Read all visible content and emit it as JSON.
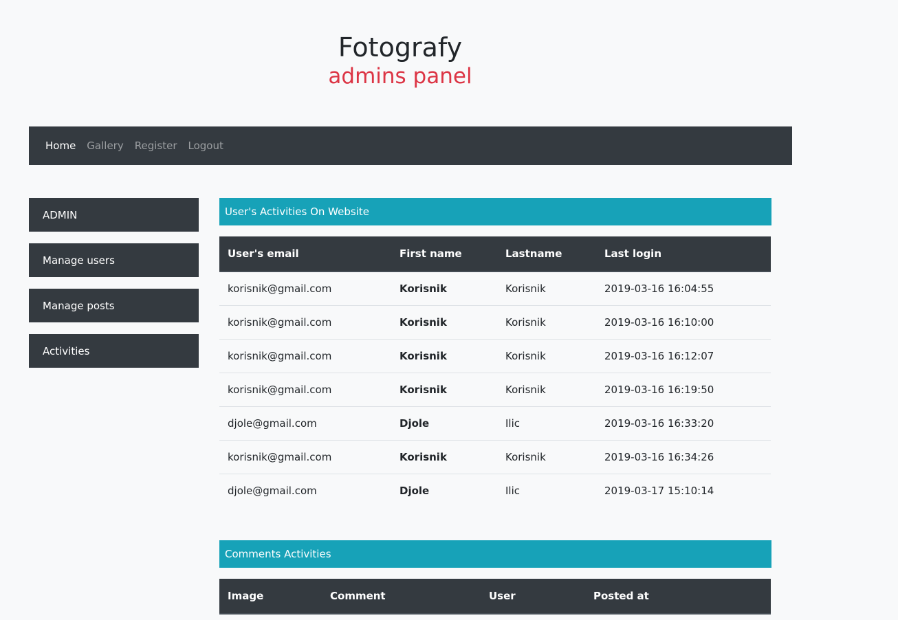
{
  "header": {
    "title": "Fotografy",
    "subtitle": "admins panel"
  },
  "navbar": {
    "links": [
      "Home",
      "Gallery",
      "Register",
      "Logout"
    ]
  },
  "sidebar": {
    "items": [
      "ADMIN",
      "Manage users",
      "Manage posts",
      "Activities"
    ]
  },
  "activities": {
    "title": "User's Activities On Website",
    "columns": [
      "User's email",
      "First name",
      "Lastname",
      "Last login"
    ],
    "rows": [
      [
        "korisnik@gmail.com",
        "Korisnik",
        "Korisnik",
        "2019-03-16 16:04:55"
      ],
      [
        "korisnik@gmail.com",
        "Korisnik",
        "Korisnik",
        "2019-03-16 16:10:00"
      ],
      [
        "korisnik@gmail.com",
        "Korisnik",
        "Korisnik",
        "2019-03-16 16:12:07"
      ],
      [
        "korisnik@gmail.com",
        "Korisnik",
        "Korisnik",
        "2019-03-16 16:19:50"
      ],
      [
        "djole@gmail.com",
        "Djole",
        "Ilic",
        "2019-03-16 16:33:20"
      ],
      [
        "korisnik@gmail.com",
        "Korisnik",
        "Korisnik",
        "2019-03-16 16:34:26"
      ],
      [
        "djole@gmail.com",
        "Djole",
        "Ilic",
        "2019-03-17 15:10:14"
      ]
    ]
  },
  "comments": {
    "title": "Comments Activities",
    "columns": [
      "Image",
      "Comment",
      "User",
      "Posted at"
    ]
  },
  "colors": {
    "dark": "#343a40",
    "info": "#17a2b8",
    "danger": "#dc3545",
    "background": "#f8f9fa"
  }
}
